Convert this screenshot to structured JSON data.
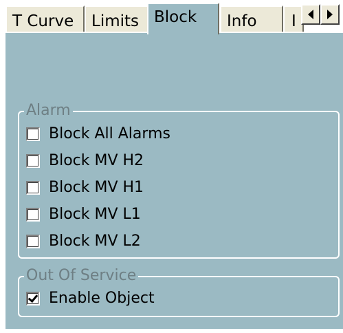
{
  "tabs": [
    {
      "label": "T Curve",
      "active": false
    },
    {
      "label": "Limits",
      "active": false
    },
    {
      "label": "Block",
      "active": true
    },
    {
      "label": "Info",
      "active": false
    },
    {
      "label": "I",
      "active": false
    }
  ],
  "scroll": {
    "left_icon": "arrow-left-icon",
    "right_icon": "arrow-right-icon"
  },
  "alarm_group": {
    "title": "Alarm",
    "items": [
      {
        "label": "Block All Alarms",
        "checked": false
      },
      {
        "label": "Block MV H2",
        "checked": false
      },
      {
        "label": "Block MV H1",
        "checked": false
      },
      {
        "label": "Block MV L1",
        "checked": false
      },
      {
        "label": "Block MV L2",
        "checked": false
      }
    ]
  },
  "oos_group": {
    "title": "Out Of Service",
    "items": [
      {
        "label": "Enable Object",
        "checked": true
      }
    ]
  },
  "colors": {
    "panel_bg": "#9bbac3",
    "tab_bg": "#ece9d8",
    "group_title": "#6e7f84"
  }
}
